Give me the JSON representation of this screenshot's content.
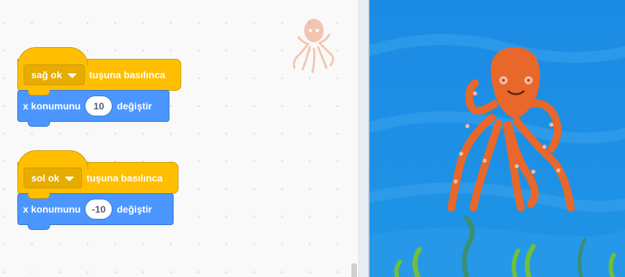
{
  "scripts": [
    {
      "hat": {
        "key_option": "sağ ok",
        "label": "tuşuna basılınca"
      },
      "motion": {
        "prefix": "x konumunu",
        "value": "10",
        "suffix": "değiştir"
      }
    },
    {
      "hat": {
        "key_option": "sol ok",
        "label": "tuşuna basılınca"
      },
      "motion": {
        "prefix": "x konumunu",
        "value": "-10",
        "suffix": "değiştir"
      }
    }
  ],
  "colors": {
    "events_block": "#ffbf00",
    "motion_block": "#4c97ff",
    "stage_water": "#1f8fe5",
    "octopus": "#e8672a"
  },
  "icons": {
    "workspace_sprite": "octopus-sprite-icon",
    "dropdown": "caret-down-icon"
  }
}
